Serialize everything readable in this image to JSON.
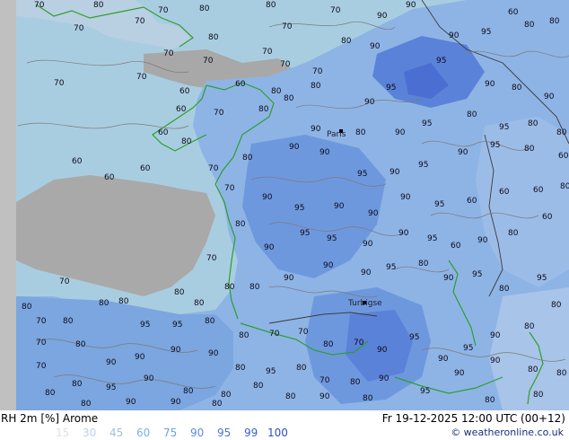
{
  "map": {
    "city_labels": [
      "Paris",
      "Turbigse"
    ],
    "contour_values": [
      "70",
      "80",
      "90",
      "95",
      "60"
    ],
    "colors": {
      "sea": "#9ec6dc",
      "land_gray": "#a8a8a8",
      "rh_60": "#a8c8e8",
      "rh_75": "#8cb2e4",
      "rh_90": "#6e98de",
      "rh_95": "#5a82d8",
      "rh_99": "#4a6ed2",
      "coast": "#2e9e2e",
      "contour": "#7b7b7b"
    }
  },
  "footer": {
    "title": "RH 2m [%] Arome",
    "validity": "Fr 19-12-2025 12:00 UTC (00+12)",
    "credit": "© weatheronline.co.uk",
    "legend": [
      {
        "label": "15",
        "color": "#d8e4ee"
      },
      {
        "label": "30",
        "color": "#bcd2e4"
      },
      {
        "label": "45",
        "color": "#9dbfe0"
      },
      {
        "label": "60",
        "color": "#7eb0e6"
      },
      {
        "label": "75",
        "color": "#6aa0e6"
      },
      {
        "label": "90",
        "color": "#5a8ce0"
      },
      {
        "label": "95",
        "color": "#4a74d8"
      },
      {
        "label": "99",
        "color": "#3a60d0"
      },
      {
        "label": "100",
        "color": "#2a4ec8"
      }
    ]
  }
}
